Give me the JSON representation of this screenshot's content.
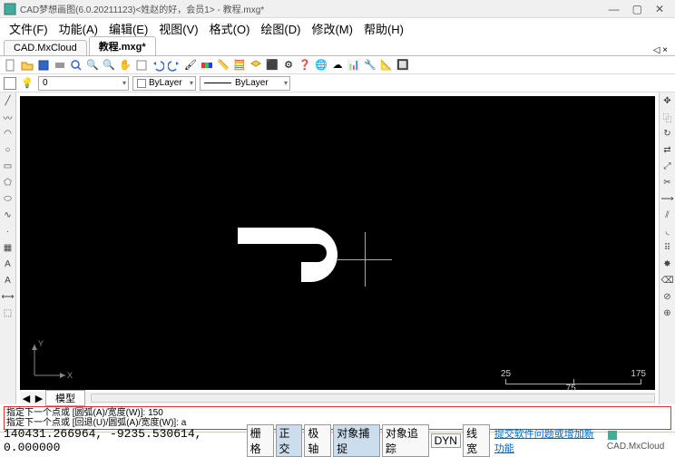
{
  "window": {
    "title": "CAD梦想画图(6.0.20211123)<姓赵的好，会员1> - 教程.mxg*",
    "min": "—",
    "max": "▢",
    "close": "✕"
  },
  "menu": {
    "file": "文件(F)",
    "func": "功能(A)",
    "edit": "编辑(E)",
    "view": "视图(V)",
    "format": "格式(O)",
    "draw": "绘图(D)",
    "modify": "修改(M)",
    "help": "帮助(H)"
  },
  "tabs": {
    "cloud": "CAD.MxCloud",
    "doc": "教程.mxg*",
    "closex": "◁ ×"
  },
  "props": {
    "layer": "0",
    "bylayer1": "ByLayer",
    "bylayer2": "ByLayer"
  },
  "model_tab": "模型",
  "scroll": {
    "l1": "◀",
    "l2": "◀",
    "r": "▶"
  },
  "scale": {
    "a": "25",
    "b": "75",
    "c": "175"
  },
  "ucs": {
    "x": "X",
    "y": "Y"
  },
  "cmd": {
    "line1": "指定下一个点或 [圆弧(A)/宽度(W)]: 150",
    "line2": "指定下一个点或 [回退(U)/圆弧(A)/宽度(W)]: a"
  },
  "status": {
    "coords": "140431.266964, -9235.530614, 0.000000",
    "grid": "栅格",
    "ortho": "正交",
    "polar": "极轴",
    "osnap": "对象捕捉",
    "otrack": "对象追踪",
    "dyn": "DYN",
    "lw": "线宽",
    "feedback": "提交软件问题或增加新功能",
    "brand": "CAD.MxCloud"
  }
}
